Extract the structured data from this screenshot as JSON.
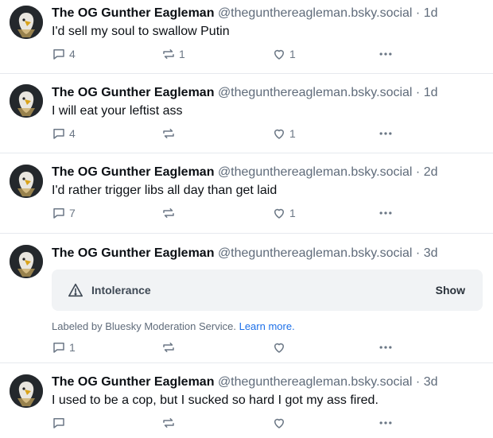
{
  "colors": {
    "text": "#0b0f14",
    "muted": "#5f6b7a",
    "link": "#1c6fe8",
    "divider": "#e6e9ee"
  },
  "posts": [
    {
      "author": "The OG Gunther Eagleman",
      "handle": "@thegunthereagleman.bsky.social",
      "separator": "·",
      "age": "1d",
      "text": "I'd sell my soul to swallow Putin",
      "replies": "4",
      "reposts": "1",
      "likes": "1"
    },
    {
      "author": "The OG Gunther Eagleman",
      "handle": "@thegunthereagleman.bsky.social",
      "separator": "·",
      "age": "1d",
      "text": "I will eat your leftist ass",
      "replies": "4",
      "reposts": "",
      "likes": "1"
    },
    {
      "author": "The OG Gunther Eagleman",
      "handle": "@thegunthereagleman.bsky.social",
      "separator": "·",
      "age": "2d",
      "text": "I'd rather trigger libs all day than get laid",
      "replies": "7",
      "reposts": "",
      "likes": "1"
    },
    {
      "author": "The OG Gunther Eagleman",
      "handle": "@thegunthereagleman.bsky.social",
      "separator": "·",
      "age": "3d",
      "warning_label": "Intolerance",
      "warning_action": "Show",
      "moderation_text": "Labeled by Bluesky Moderation Service.",
      "moderation_link": "Learn more.",
      "replies": "1",
      "reposts": "",
      "likes": ""
    },
    {
      "author": "The OG Gunther Eagleman",
      "handle": "@thegunthereagleman.bsky.social",
      "separator": "·",
      "age": "3d",
      "text": "I used to be a cop, but I sucked so hard I got my ass fired.",
      "replies": "",
      "reposts": "",
      "likes": ""
    }
  ]
}
